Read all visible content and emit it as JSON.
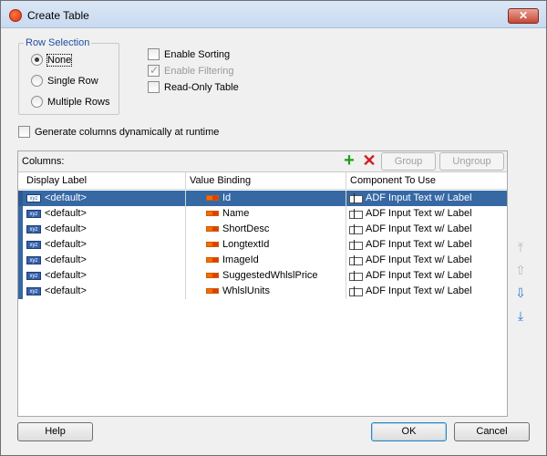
{
  "window": {
    "title": "Create Table",
    "close_label": "✕"
  },
  "row_selection": {
    "legend": "Row Selection",
    "options": [
      {
        "label": "None",
        "selected": true
      },
      {
        "label": "Single Row",
        "selected": false
      },
      {
        "label": "Multiple Rows",
        "selected": false
      }
    ]
  },
  "options": {
    "enable_sorting": {
      "label": "Enable Sorting",
      "checked": false
    },
    "enable_filtering": {
      "label": "Enable Filtering",
      "checked": true,
      "disabled": true
    },
    "read_only": {
      "label": "Read-Only Table",
      "checked": false
    }
  },
  "generate_columns": {
    "label": "Generate columns dynamically at runtime",
    "checked": false
  },
  "columns_panel": {
    "label": "Columns:",
    "add_icon": "plus-icon",
    "delete_icon": "delete-x-icon",
    "group_label": "Group",
    "ungroup_label": "Ungroup",
    "headers": [
      "Display Label",
      "Value Binding",
      "Component To Use"
    ],
    "rows": [
      {
        "display": "<default>",
        "binding": "Id",
        "component": "ADF Input Text w/ Label",
        "selected": true
      },
      {
        "display": "<default>",
        "binding": "Name",
        "component": "ADF Input Text w/ Label",
        "selected": false
      },
      {
        "display": "<default>",
        "binding": "ShortDesc",
        "component": "ADF Input Text w/ Label",
        "selected": false
      },
      {
        "display": "<default>",
        "binding": "LongtextId",
        "component": "ADF Input Text w/ Label",
        "selected": false
      },
      {
        "display": "<default>",
        "binding": "ImageId",
        "component": "ADF Input Text w/ Label",
        "selected": false
      },
      {
        "display": "<default>",
        "binding": "SuggestedWhlslPrice",
        "component": "ADF Input Text w/ Label",
        "selected": false
      },
      {
        "display": "<default>",
        "binding": "WhlslUnits",
        "component": "ADF Input Text w/ Label",
        "selected": false
      }
    ]
  },
  "move_buttons": [
    {
      "name": "move-top-icon",
      "glyph": "⤒",
      "enabled": false
    },
    {
      "name": "move-up-icon",
      "glyph": "⇧",
      "enabled": false
    },
    {
      "name": "move-down-icon",
      "glyph": "⇩",
      "enabled": true
    },
    {
      "name": "move-bottom-icon",
      "glyph": "⤓",
      "enabled": true
    }
  ],
  "buttons": {
    "help": "Help",
    "ok": "OK",
    "cancel": "Cancel"
  },
  "colors": {
    "selection": "#3669a4",
    "legend": "#1e4ea0",
    "accent_close": "#c74634"
  }
}
